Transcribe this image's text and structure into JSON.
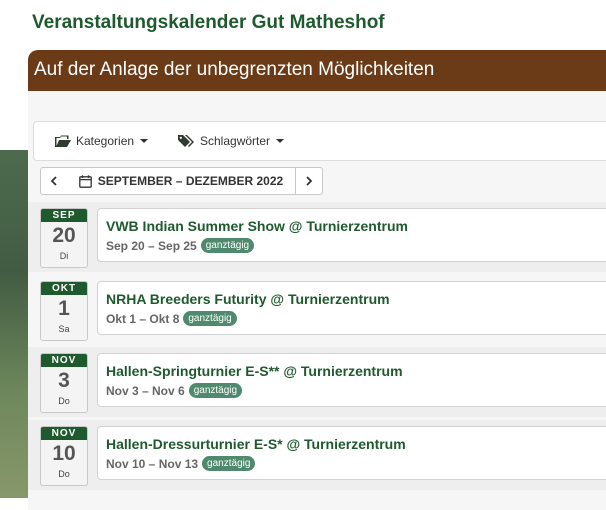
{
  "page_title": "Veranstaltungskalender Gut Matheshof",
  "calendar": {
    "header": "Auf der Anlage der unbegrenzten Möglichkeiten",
    "filters": {
      "categories": "Kategorien",
      "tags": "Schlagwörter"
    },
    "range_label": "SEPTEMBER – DEZEMBER 2022",
    "allday_label": "ganztägig",
    "events": [
      {
        "month": "SEP",
        "day": "20",
        "weekday": "Di",
        "title": "VWB Indian Summer Show @ Turnierzentrum",
        "dates": "Sep 20 – Sep 25"
      },
      {
        "month": "OKT",
        "day": "1",
        "weekday": "Sa",
        "title": "NRHA Breeders Futurity @ Turnierzentrum",
        "dates": "Okt 1 – Okt 8"
      },
      {
        "month": "NOV",
        "day": "3",
        "weekday": "Do",
        "title": "Hallen-Springturnier E-S** @ Turnierzentrum",
        "dates": "Nov 3 – Nov 6"
      },
      {
        "month": "NOV",
        "day": "10",
        "weekday": "Do",
        "title": "Hallen-Dressurturnier E-S* @ Turnierzentrum",
        "dates": "Nov 10 – Nov 13"
      }
    ]
  },
  "colors": {
    "brand_green": "#1f5a2e",
    "header_brown": "#6b3b18",
    "allday_badge": "#4f8a6e"
  },
  "icons": [
    "folder-open-icon",
    "tags-icon",
    "chevron-left-icon",
    "calendar-icon",
    "chevron-right-icon"
  ]
}
